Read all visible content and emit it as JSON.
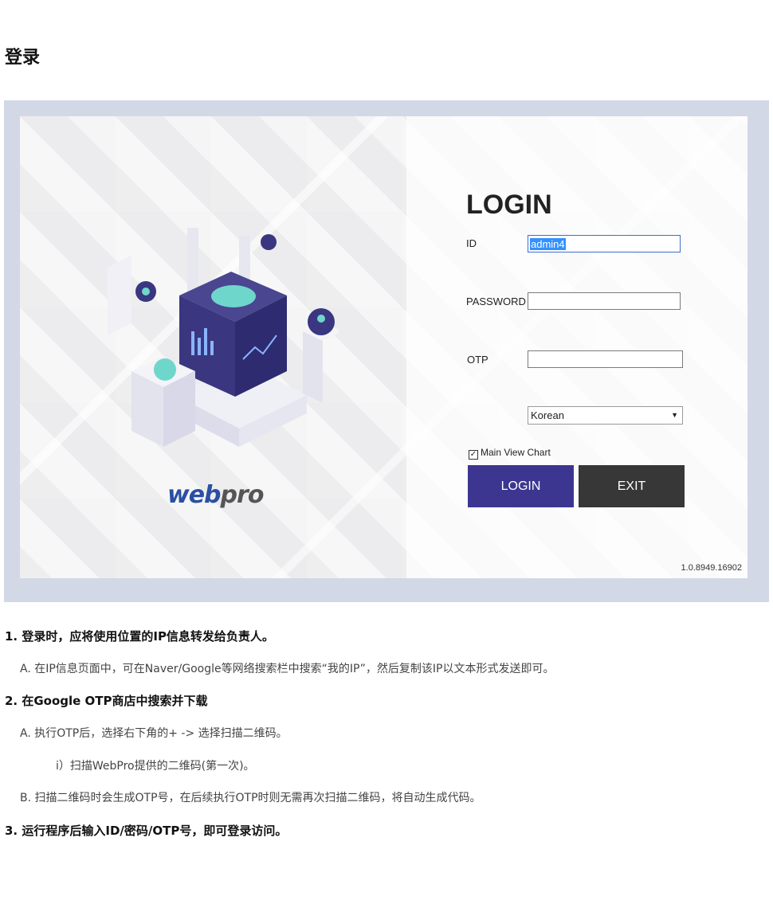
{
  "page": {
    "title": "登录"
  },
  "login_window": {
    "heading": "LOGIN",
    "id_label": "ID",
    "id_value": "admin4",
    "password_label": "PASSWORD",
    "password_value": "",
    "otp_label": "OTP",
    "otp_value": "",
    "language_selected": "Korean",
    "main_view_chart_label": "Main View Chart",
    "main_view_chart_checked": true,
    "login_button": "LOGIN",
    "exit_button": "EXIT",
    "version": "1.0.8949.16902",
    "logo_text_a": "web",
    "logo_text_b": "pro",
    "colors": {
      "login_button": "#3d3690",
      "exit_button": "#373737",
      "frame": "#d2d8e6"
    }
  },
  "instructions": {
    "step1": "1. 登录时，应将使用位置的IP信息转发给负责人。",
    "step1_a": "A.  在IP信息页面中，可在Naver/Google等网络搜索栏中搜索“我的IP”，然后复制该IP以文本形式发送即可。",
    "step2": "2. 在Google OTP商店中搜索并下载",
    "step2_a": "A.  执行OTP后，选择右下角的+ -> 选择扫描二维码。",
    "step2_a_i": "ⅰ）扫描WebPro提供的二维码(第一次)。",
    "step2_b": "B.  扫描二维码时会生成OTP号，在后续执行OTP时则无需再次扫描二维码，将自动生成代码。",
    "step3": "3. 运行程序后输入ID/密码/OTP号，即可登录访问。"
  }
}
